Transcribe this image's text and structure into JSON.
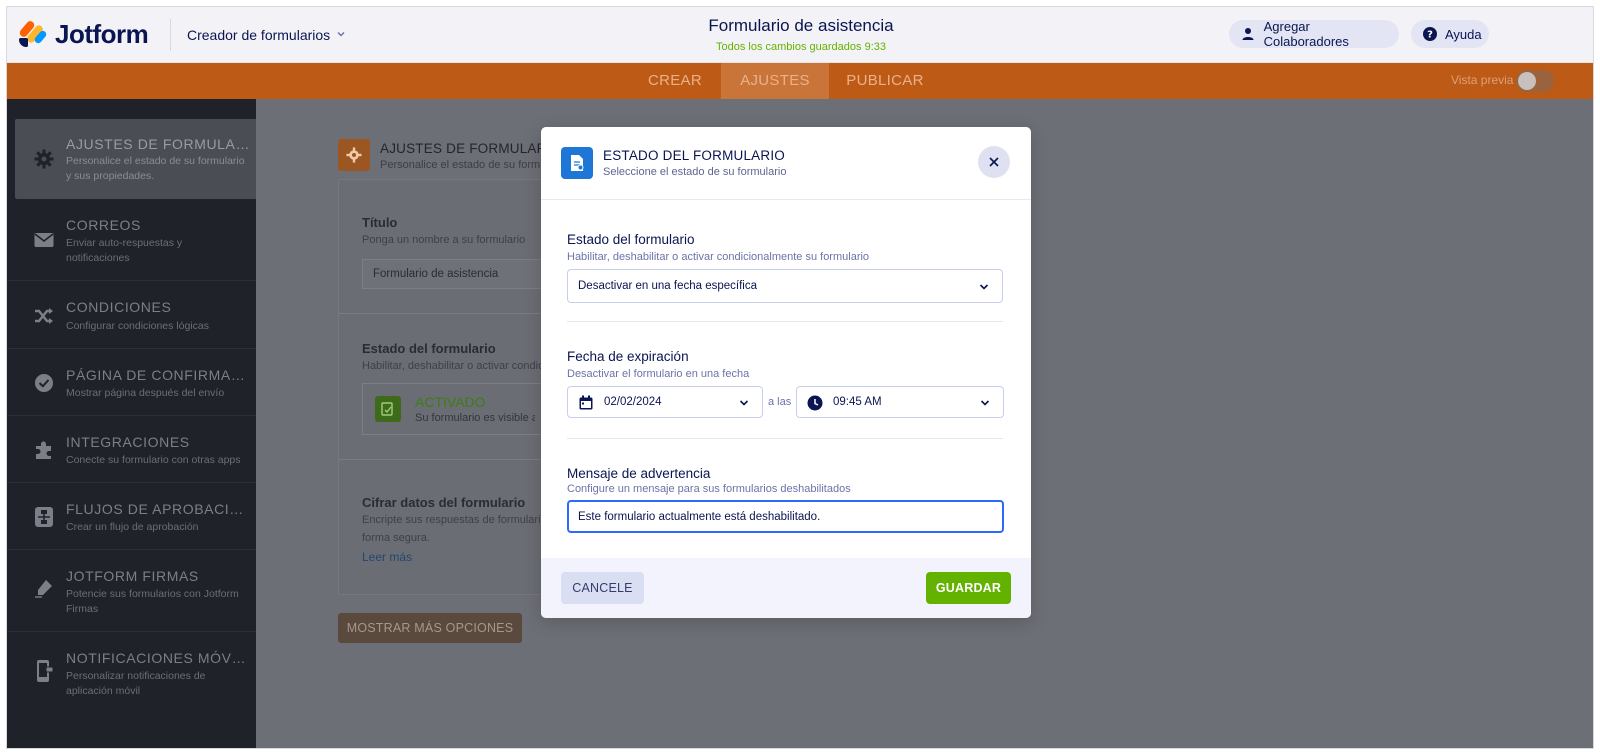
{
  "app": {
    "logo_text": "Jotform",
    "builder_label": "Creador de formularios",
    "form_title": "Formulario de asistencia",
    "saved_status": "Todos los cambios guardados 9:33",
    "collaborators_label": "Agregar Colaboradores",
    "help_label": "Ayuda"
  },
  "nav": {
    "tabs": [
      {
        "label": "CREAR"
      },
      {
        "label": "AJUSTES"
      },
      {
        "label": "PUBLICAR"
      }
    ],
    "preview_label": "Vista previa"
  },
  "sidebar": {
    "items": [
      {
        "title": "AJUSTES DE FORMULARIO",
        "desc": "Personalice el estado de su formulario y sus propiedades.",
        "icon": "gear-icon"
      },
      {
        "title": "CORREOS",
        "desc": "Enviar auto-respuestas y notificaciones",
        "icon": "envelope-icon"
      },
      {
        "title": "CONDICIONES",
        "desc": "Configurar condiciones lógicas",
        "icon": "shuffle-icon"
      },
      {
        "title": "PÁGINA DE CONFIRMACI...",
        "desc": "Mostrar página después del envío",
        "icon": "check-circle-icon"
      },
      {
        "title": "INTEGRACIONES",
        "desc": "Conecte su formulario con otras apps",
        "icon": "puzzle-icon"
      },
      {
        "title": "FLUJOS DE APROBACIÓN",
        "desc": "Crear un flujo de aprobación",
        "icon": "approval-flow-icon"
      },
      {
        "title": "JOTFORM FIRMAS",
        "desc": "Potencie sus formularios con Jotform Firmas",
        "icon": "pen-icon"
      },
      {
        "title": "NOTIFICACIONES MÓVIL...",
        "desc": "Personalizar notificaciones de aplicación móvil",
        "icon": "mobile-icon"
      }
    ]
  },
  "settings_bg": {
    "header_title": "AJUSTES DE FORMULARIO",
    "header_desc": "Personalice el estado de su formulario",
    "title_label": "Título",
    "title_sub": "Ponga un nombre a su formulario",
    "title_value": "Formulario de asistencia",
    "status_label": "Estado del formulario",
    "status_sub": "Habilitar, deshabilitar o activar condicionalmente su formulario",
    "status_value": "ACTIVADO",
    "status_value_desc": "Su formulario es visible a los usuarios",
    "encrypt_label": "Cifrar datos del formulario",
    "encrypt_desc_1": "Encripte sus respuestas de formulario de",
    "encrypt_desc_2": "forma segura.",
    "learn_more": "Leer más",
    "more_options": "MOSTRAR MÁS OPCIONES"
  },
  "modal": {
    "title": "ESTADO DEL FORMULARIO",
    "subtitle": "Seleccione el estado de su formulario",
    "status_label": "Estado del formulario",
    "status_sub": "Habilitar, deshabilitar o activar condicionalmente su formulario",
    "status_selected": "Desactivar en una fecha específica",
    "expiry_label": "Fecha de expiración",
    "expiry_sub": "Desactivar el formulario en una fecha",
    "date_value": "02/02/2024",
    "at_label": "a las",
    "time_value": "09:45 AM",
    "warning_label": "Mensaje de advertencia",
    "warning_sub": "Configure un mensaje para sus formularios deshabilitados",
    "warning_value": "Este formulario actualmente está deshabilitado.",
    "cancel_label": "CANCELE",
    "save_label": "GUARDAR"
  },
  "colors": {
    "brand_navy": "#0a1551",
    "nav_orange": "#bd5b16",
    "save_green": "#64b200",
    "focus_blue": "#2e69ff",
    "modal_icon_blue": "#1e77d6"
  }
}
